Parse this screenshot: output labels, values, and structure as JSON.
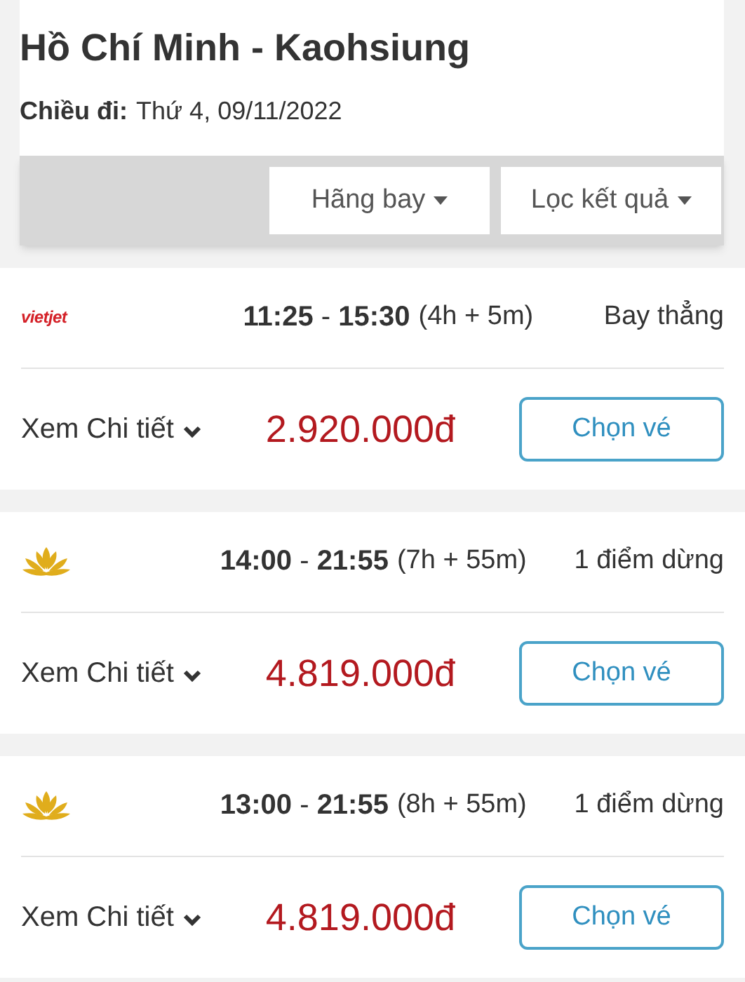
{
  "header": {
    "title": "Hồ Chí Minh - Kaohsiung",
    "date_label": "Chiều đi:",
    "date": "Thứ 4, 09/11/2022"
  },
  "filters": [
    {
      "label": "Hãng bay"
    },
    {
      "label": "Lọc kết quả"
    }
  ],
  "flights": [
    {
      "airline": {
        "kind": "vietjet",
        "text": "vietjet"
      },
      "times": "**11:25** - **15:30**",
      "duration": "(4h + 5m)",
      "stops": "Bay thẳng",
      "details": "Xem Chi tiết",
      "price": "2.920.000đ",
      "button": "Chọn vé"
    },
    {
      "airline": {
        "kind": "lotus"
      },
      "times": "**14:00** - **21:55**",
      "duration": "(7h + 55m)",
      "stops": "1 điểm dừng",
      "details": "Xem Chi tiết",
      "price": "4.819.000đ",
      "button": "Chọn vé"
    },
    {
      "airline": {
        "kind": "lotus"
      },
      "times": "**13:00** - **21:55**",
      "duration": "(8h + 55m)",
      "stops": "1 điểm dừng",
      "details": "Xem Chi tiết",
      "price": "4.819.000đ",
      "button": "Chọn vé"
    }
  ]
}
